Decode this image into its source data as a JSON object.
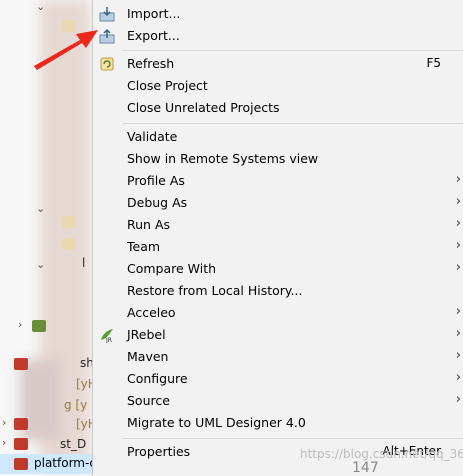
{
  "menu": {
    "import": "Import...",
    "export": "Export...",
    "refresh": "Refresh",
    "refresh_shortcut": "F5",
    "close_project": "Close Project",
    "close_unrelated": "Close Unrelated Projects",
    "validate": "Validate",
    "show_remote": "Show in Remote Systems view",
    "profile_as": "Profile As",
    "debug_as": "Debug As",
    "run_as": "Run As",
    "team": "Team",
    "compare_with": "Compare With",
    "restore_history": "Restore from Local History...",
    "acceleo": "Acceleo",
    "jrebel": "JRebel",
    "maven": "Maven",
    "configure": "Configure",
    "source": "Source",
    "migrate_uml": "Migrate to UML Designer 4.0",
    "properties": "Properties",
    "properties_shortcut": "Alt+Enter",
    "submenu_glyph": "›"
  },
  "explorer": {
    "frag_sh": "sh",
    "frag_yh1": "[yH",
    "frag_g": "g [y",
    "frag_yh2": "[yH",
    "frag_st_d": "st_D",
    "frag_l": "l",
    "selected_project": "platform-ca- ca-co-"
  },
  "watermark": "https://blog.csdn.net/qq_36",
  "status_number": "147",
  "colors": {
    "menu_bg": "#f2f2f2",
    "arrow": "#e8291c",
    "selection": "#cde8ff"
  },
  "icons": [
    "import-icon",
    "export-icon",
    "refresh-icon",
    "jrebel-icon",
    "arrow-annotation"
  ]
}
